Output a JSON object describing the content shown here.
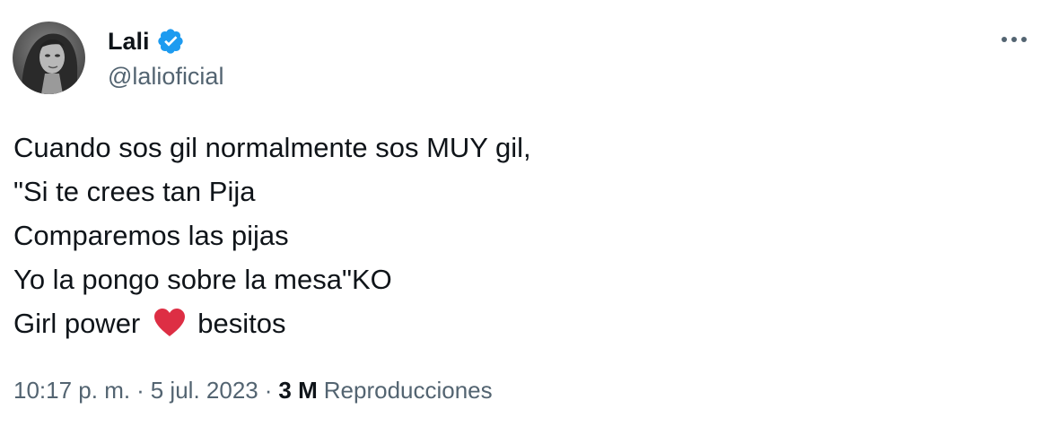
{
  "user": {
    "display_name": "Lali",
    "handle": "@lalioficial",
    "verified_color": "#1d9bf0"
  },
  "tweet": {
    "lines": [
      "Cuando sos gil normalmente sos MUY gil,",
      "\"Si te crees tan Pija",
      "Comparemos las pijas",
      "Yo la pongo sobre la mesa\"KO"
    ],
    "last_line_before_emoji": "Girl power",
    "emoji": "red-heart",
    "last_line_after_emoji": "besitos"
  },
  "meta": {
    "time": "10:17 p. m.",
    "separator": "·",
    "date": "5 jul. 2023",
    "views_count": "3 M",
    "views_label": "Reproducciones"
  },
  "icons": {
    "more": "more-horizontal-icon",
    "verified": "verified-badge-icon"
  }
}
